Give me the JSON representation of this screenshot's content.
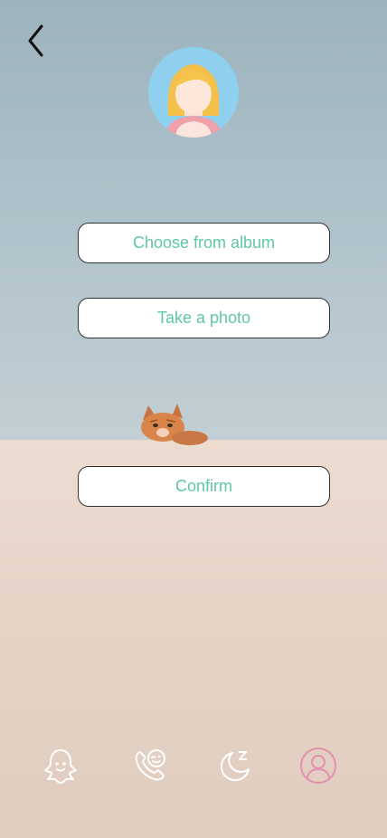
{
  "buttons": {
    "choose_album": "Choose from album",
    "take_photo": "Take a photo",
    "confirm": "Confirm"
  },
  "icons": {
    "back": "chevron-left-icon",
    "avatar": "girl-avatar",
    "tabs": [
      "ghost-icon",
      "phone-icon",
      "moon-sleep-icon",
      "profile-icon"
    ]
  },
  "colors": {
    "accent_text": "#5ec7a8",
    "active_tab": "#e58fae",
    "inactive_tab": "#ffffff"
  },
  "tabbar": {
    "active_index": 3
  }
}
